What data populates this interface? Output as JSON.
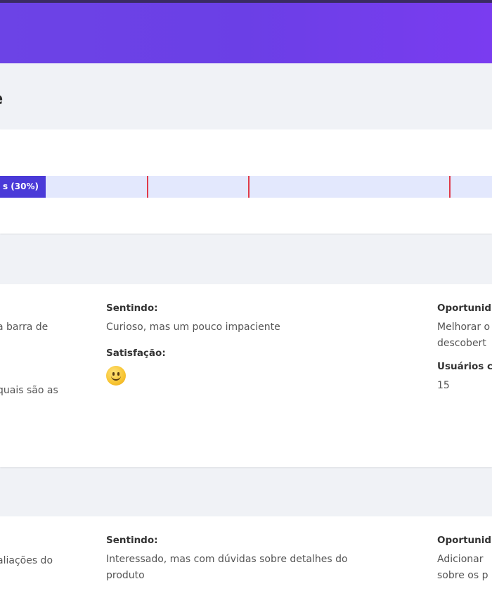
{
  "header": {},
  "page": {
    "title": "e"
  },
  "progress": {
    "fill_label": "s (30%)",
    "fill_percent": 30
  },
  "stages": [
    {
      "left_text_1": "a barra de",
      "left_text_2": "quais são as",
      "feeling_label": "Sentindo:",
      "feeling_value": "Curioso, mas um pouco impaciente",
      "satisfaction_label": "Satisfação:",
      "satisfaction_icon": "slightly-smiling-face-icon",
      "opportunity_label": "Oportunid",
      "opportunity_value_1": "Melhorar o",
      "opportunity_value_2": "descobert",
      "users_label": "Usuários c",
      "users_value": "15"
    },
    {
      "left_text_1": "aliações do",
      "feeling_label": "Sentindo:",
      "feeling_value_1": "Interessado, mas com dúvidas sobre detalhes do",
      "feeling_value_2": "produto",
      "opportunity_label": "Oportunid",
      "opportunity_value_1": "Adicionar",
      "opportunity_value_2": "sobre os p"
    }
  ],
  "colors": {
    "header_start": "#6c43e6",
    "header_end": "#7a3cf0",
    "progress_fill": "#4a3ad8",
    "progress_track": "#e3e8fd",
    "marker": "#e03a4a"
  }
}
